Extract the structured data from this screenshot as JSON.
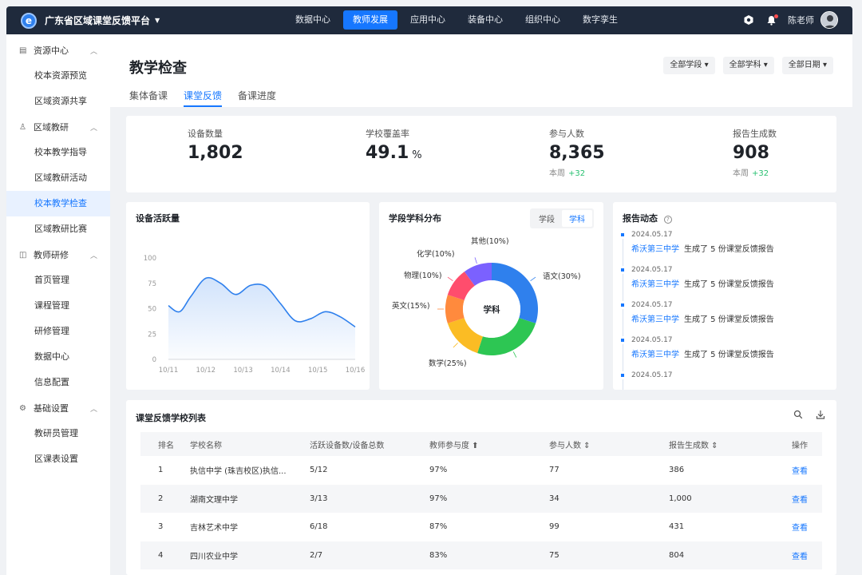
{
  "app": {
    "title": "广东省区域课堂反馈平台",
    "logo_letter": "e"
  },
  "topnav": [
    {
      "label": "数据中心",
      "active": false
    },
    {
      "label": "教师发展",
      "active": true
    },
    {
      "label": "应用中心",
      "active": false
    },
    {
      "label": "装备中心",
      "active": false
    },
    {
      "label": "组织中心",
      "active": false
    },
    {
      "label": "数字孪生",
      "active": false
    }
  ],
  "user": {
    "name": "陈老师"
  },
  "sidebar": {
    "groups": [
      {
        "label": "资源中心",
        "icon": "document-icon",
        "items": [
          "校本资源预览",
          "区域资源共享"
        ]
      },
      {
        "label": "区域教研",
        "icon": "user-icon",
        "items": [
          "校本教学指导",
          "区域教研活动",
          "校本教学检查",
          "区域教研比赛"
        ]
      },
      {
        "label": "教师研修",
        "icon": "book-icon",
        "items": [
          "首页管理",
          "课程管理",
          "研修管理",
          "数据中心",
          "信息配置"
        ]
      },
      {
        "label": "基础设置",
        "icon": "gear-icon",
        "items": [
          "教研员管理",
          "区课表设置"
        ]
      }
    ],
    "active_item": "校本教学检查"
  },
  "page": {
    "title": "教学检查",
    "tabs": [
      {
        "label": "集体备课",
        "active": false
      },
      {
        "label": "课堂反馈",
        "active": true
      },
      {
        "label": "备课进度",
        "active": false
      }
    ],
    "filters": [
      "全部学段",
      "全部学科",
      "全部日期"
    ]
  },
  "stats": [
    {
      "label": "设备数量",
      "value": "1,802",
      "unit": "",
      "sub_label": "",
      "sub_value": ""
    },
    {
      "label": "学校覆盖率",
      "value": "49.1",
      "unit": "%",
      "sub_label": "",
      "sub_value": ""
    },
    {
      "label": "参与人数",
      "value": "8,365",
      "unit": "",
      "sub_label": "本周",
      "sub_value": "+32"
    },
    {
      "label": "报告生成数",
      "value": "908",
      "unit": "",
      "sub_label": "本周",
      "sub_value": "+32"
    }
  ],
  "activity_chart": {
    "title": "设备活跃量"
  },
  "pie_chart": {
    "title": "学段学科分布",
    "toggle": [
      "学段",
      "学科"
    ],
    "active_toggle": "学科",
    "center_label": "学科"
  },
  "feed": {
    "title": "报告动态",
    "items": [
      {
        "date": "2024.05.17",
        "school": "希沃第三中学",
        "text": "生成了 5 份课堂反馈报告"
      },
      {
        "date": "2024.05.17",
        "school": "希沃第三中学",
        "text": "生成了 5 份课堂反馈报告"
      },
      {
        "date": "2024.05.17",
        "school": "希沃第三中学",
        "text": "生成了 5 份课堂反馈报告"
      },
      {
        "date": "2024.05.17",
        "school": "希沃第三中学",
        "text": "生成了 5 份课堂反馈报告"
      },
      {
        "date": "2024.05.17",
        "school": "",
        "text": ""
      }
    ]
  },
  "table": {
    "title": "课堂反馈学校列表",
    "headers": [
      "排名",
      "学校名称",
      "活跃设备数/设备总数",
      "教师参与度 ⬆",
      "参与人数 ⇕",
      "报告生成数 ⇕",
      "操作"
    ],
    "rows": [
      [
        "1",
        "执信中学 (珠吉校区)执信...",
        "5/12",
        "97%",
        "77",
        "386",
        "查看"
      ],
      [
        "2",
        "湖南文理中学",
        "3/13",
        "97%",
        "34",
        "1,000",
        "查看"
      ],
      [
        "3",
        "吉林艺术中学",
        "6/18",
        "87%",
        "99",
        "431",
        "查看"
      ],
      [
        "4",
        "四川农业中学",
        "2/7",
        "83%",
        "75",
        "804",
        "查看"
      ]
    ]
  },
  "colors": {
    "accent": "#1677ff",
    "topbar": "#1f2a3c",
    "positive": "#27c070"
  },
  "chart_data": [
    {
      "type": "area",
      "title": "设备活跃量",
      "x": [
        "10/11",
        "10/12",
        "10/13",
        "10/14",
        "10/15",
        "10/16"
      ],
      "xticks": [
        "10/11",
        "10/12",
        "10/13",
        "10/14",
        "10/15",
        "10/16"
      ],
      "yticks": [
        "100",
        "75",
        "50",
        "25",
        "0"
      ],
      "ylim": [
        0,
        100
      ],
      "points": [
        [
          0,
          53
        ],
        [
          0.3,
          47
        ],
        [
          0.6,
          62
        ],
        [
          1.0,
          80
        ],
        [
          1.4,
          75
        ],
        [
          1.8,
          64
        ],
        [
          2.2,
          73
        ],
        [
          2.6,
          72
        ],
        [
          3.0,
          55
        ],
        [
          3.4,
          38
        ],
        [
          3.8,
          40
        ],
        [
          4.2,
          47
        ],
        [
          4.6,
          42
        ],
        [
          5.0,
          32
        ]
      ],
      "color": "#2f80ed",
      "grid": false
    },
    {
      "type": "pie",
      "title": "学段学科分布",
      "donut": true,
      "slices": [
        {
          "label": "语文(30%)",
          "value": 30,
          "color": "#2f80ed"
        },
        {
          "label": "数学(25%)",
          "value": 25,
          "color": "#2dc653"
        },
        {
          "label": "英文(15%)",
          "value": 15,
          "color": "#fbbc24"
        },
        {
          "label": "物理(10%)",
          "value": 10,
          "color": "#ff8a3d"
        },
        {
          "label": "化学(10%)",
          "value": 10,
          "color": "#ff4d6d"
        },
        {
          "label": "其他(10%)",
          "value": 10,
          "color": "#7b61ff"
        }
      ]
    }
  ]
}
